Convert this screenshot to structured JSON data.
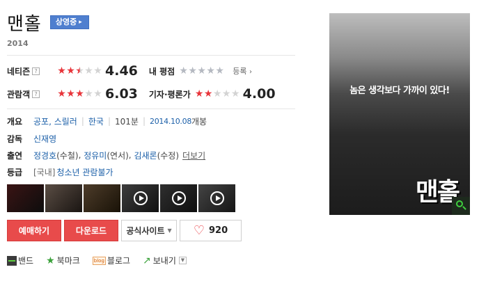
{
  "movie": {
    "title": "맨홀",
    "status": "상영중",
    "year": "2014"
  },
  "ratings": {
    "netizen": {
      "label": "네티즌",
      "score": "4.46",
      "stars": 2.5
    },
    "my": {
      "label": "내 평점",
      "link": "등록"
    },
    "audience": {
      "label": "관람객",
      "score": "6.03",
      "stars": 3
    },
    "critic": {
      "label": "기자·평론가",
      "score": "4.00",
      "stars": 2
    },
    "help_icon": "?"
  },
  "info": {
    "outline": {
      "label": "개요",
      "genre": "공포, 스릴러",
      "country": "한국",
      "runtime": "101분",
      "release_date": "2014.10.08",
      "release_suffix": "개봉"
    },
    "director": {
      "label": "감독",
      "name": "신재영"
    },
    "cast": {
      "label": "출연",
      "actors": [
        "정경호",
        "정유미",
        "김새론"
      ],
      "roles": [
        "(수철)",
        "(연서)",
        "(수정)"
      ],
      "more": "더보기"
    },
    "grade": {
      "label": "등급",
      "region": "[국내]",
      "rating": "청소년 관람불가"
    }
  },
  "thumbnails": [
    {
      "video": false
    },
    {
      "video": false
    },
    {
      "video": false
    },
    {
      "video": true
    },
    {
      "video": true
    },
    {
      "video": true
    }
  ],
  "actions": {
    "reserve": "예매하기",
    "download": "다운로드",
    "official_site": "공식사이트",
    "like_count": "920"
  },
  "share": {
    "band": "밴드",
    "bookmark": "북마크",
    "blog": "블로그",
    "blog_icon_text": "blog",
    "send": "보내기"
  },
  "poster": {
    "tagline": "놈은 생각보다 가까이 있다!",
    "title": "맨홀"
  },
  "colors": {
    "accent_red": "#e84b4b",
    "link_blue": "#1b5fa8",
    "badge_blue": "#4f7fcf",
    "star_red": "#e8343a"
  }
}
